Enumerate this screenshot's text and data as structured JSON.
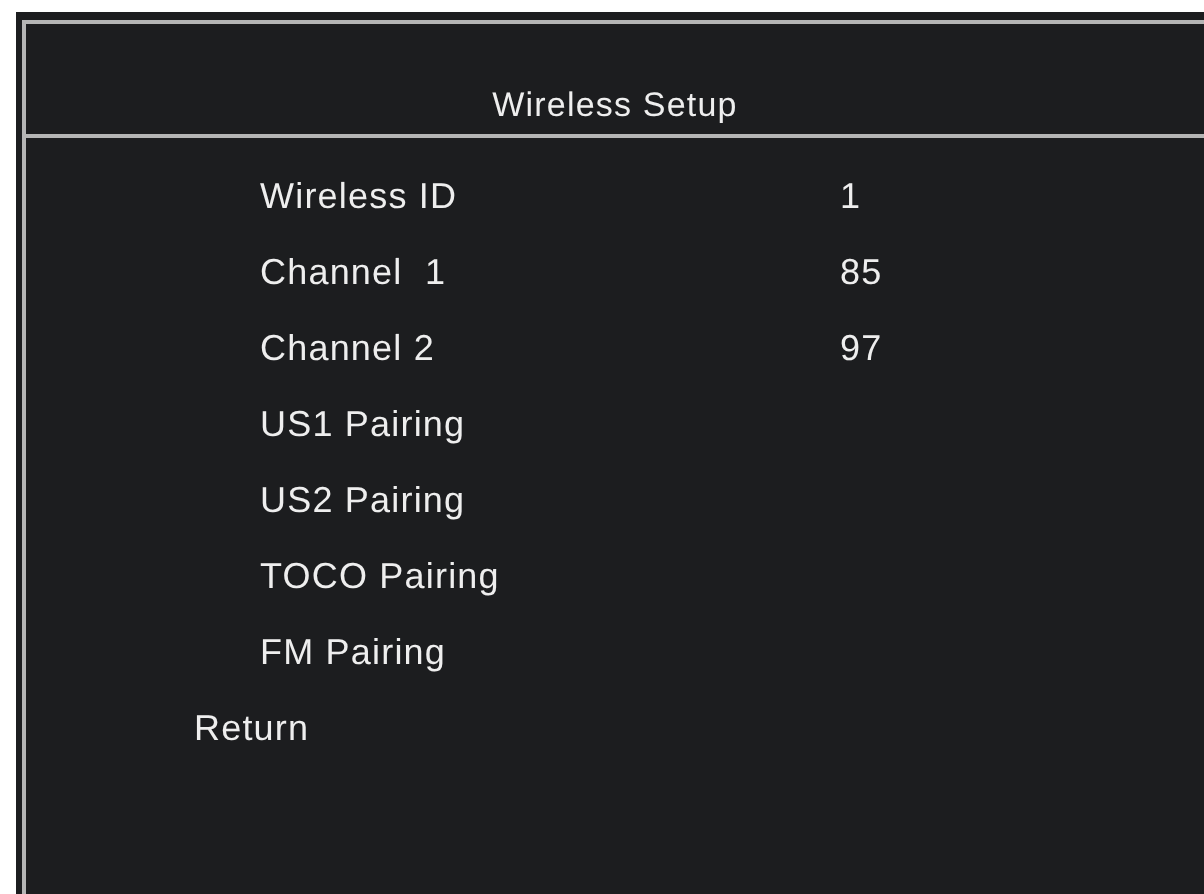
{
  "title": "Wireless Setup",
  "items": [
    {
      "label": "Wireless ID",
      "value": "1"
    },
    {
      "label": "Channel  1",
      "value": "85"
    },
    {
      "label": "Channel 2",
      "value": "97"
    },
    {
      "label": "US1 Pairing"
    },
    {
      "label": "US2 Pairing"
    },
    {
      "label": "TOCO Pairing"
    },
    {
      "label": "FM Pairing"
    }
  ],
  "return_label": "Return"
}
